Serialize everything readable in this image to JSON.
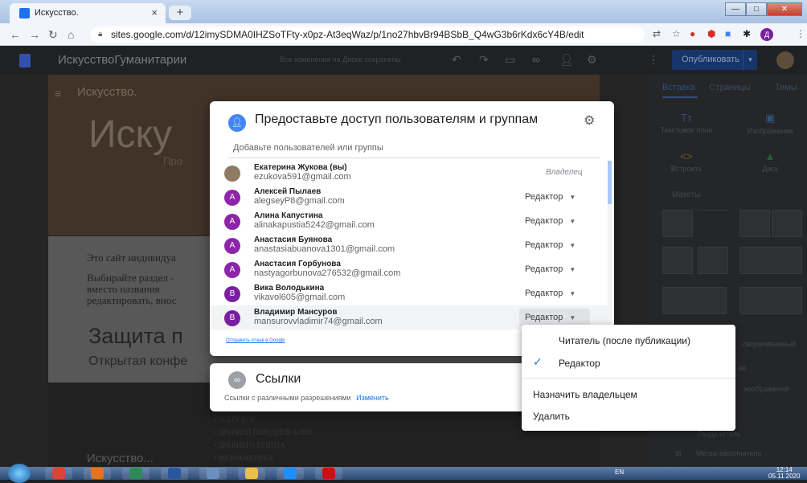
{
  "browser": {
    "tab_title": "Искусство.",
    "tab_close": "×",
    "new_tab": "+",
    "window_buttons": [
      "—",
      "□",
      "✕"
    ],
    "url": "sites.google.com/d/12imySDMA0IHZSoTFty-x0pz-At3eqWaz/p/1no27hbvBr94BSbB_Q4wG3b6rKdx6cY4B/edit"
  },
  "editor": {
    "site_name": "ИскусствоГуманитарии",
    "draft_info": "Все изменения на Диске сохранены",
    "publish_label": "Опубликовать",
    "publish_arrow": "▾"
  },
  "canvas": {
    "site_title_small": "Искусство.",
    "big_title": "Иску",
    "pro_text": "Про",
    "paragraph1": "Это сайт индивидуа",
    "paragraph2_lines": [
      "Выбирайте раздел -",
      "вместо   названия",
      "редактировать, внос"
    ],
    "section_title": "Защита п",
    "conference": "Открытая конфе",
    "bottom_title": "Искусство...",
    "bullets": [
      "• ЭГЕЙСКОЕ",
      "• ДРЕВНЕЙ ПЕРЕДНЕЙ АЗИИ",
      "• ДРЕВНЕГО ЕГИПТА",
      "• МЕЗОАМЕРИКИ"
    ]
  },
  "right_panel": {
    "tabs": [
      "Вставка",
      "Страницы",
      "Темы"
    ],
    "items": [
      {
        "label": "Текстовое поле",
        "icon": "Tт"
      },
      {
        "label": "Изображения",
        "icon": "▣"
      },
      {
        "label": "Встроить",
        "icon": "<>"
      },
      {
        "label": "Диск",
        "icon": "▲"
      }
    ],
    "layouts_label": "Макеты",
    "side_texts": [
      "сворачиваемый",
      "ие",
      "изображений",
      "Разделитель",
      "Метка-заполнитель"
    ]
  },
  "share_dialog": {
    "title": "Предоставьте доступ пользователям и группам",
    "add_placeholder": "Добавьте пользователей или группы",
    "owner_label": "Владелец",
    "feedback_link": "Отправить отзыв в Google",
    "people": [
      {
        "name": "Екатерина Жукова (вы)",
        "email": "ezukova591@gmail.com",
        "role": "",
        "avatar": "",
        "photo": true
      },
      {
        "name": "Алексей Пылаев",
        "email": "alegseyP8@gmail.com",
        "role": "Редактор",
        "avatar": "А"
      },
      {
        "name": "Алина Капустина",
        "email": "alinakapustia5242@gmail.com",
        "role": "Редактор",
        "avatar": "А"
      },
      {
        "name": "Анастасия Буянова",
        "email": "anastasiabuanova1301@gmail.com",
        "role": "Редактор",
        "avatar": "А"
      },
      {
        "name": "Анастасия Горбунова",
        "email": "nastyagorbunova276532@gmail.com",
        "role": "Редактор",
        "avatar": "А"
      },
      {
        "name": "Вика Володькина",
        "email": "vikavol605@gmail.com",
        "role": "Редактор",
        "avatar": "В"
      },
      {
        "name": "Владимир Мансуров",
        "email": "mansurovvladimir74@gmail.com",
        "role": "Редактор",
        "avatar": "В"
      }
    ]
  },
  "links_dialog": {
    "title": "Ссылки",
    "description": "Ссылки с различными разрешениями",
    "change_link": "Изменить"
  },
  "role_menu": {
    "viewer": "Читатель (после публикации)",
    "editor": "Редактор",
    "make_owner": "Назначить владельцем",
    "remove": "Удалить",
    "checkmark": "✓"
  },
  "taskbar": {
    "lang": "EN",
    "time": "12:14",
    "date": "05.11.2020"
  },
  "colors": {
    "accent": "#1a73e8",
    "avatar_purple": "#8e24aa",
    "avatar_violet": "#7b1fa2"
  }
}
